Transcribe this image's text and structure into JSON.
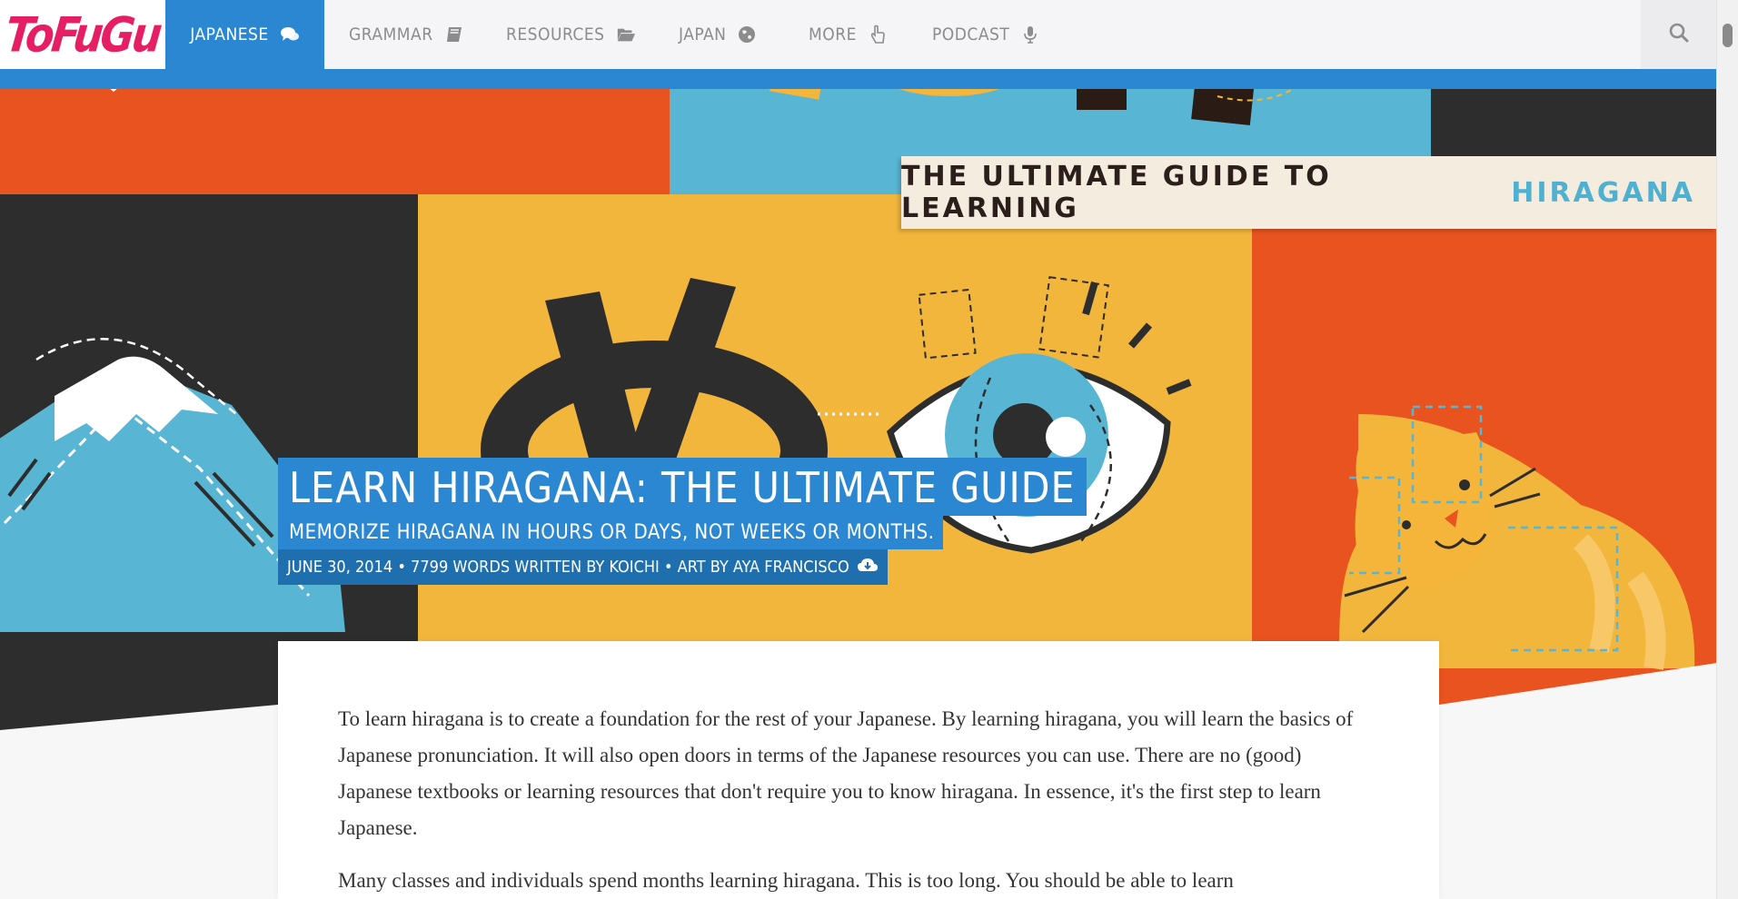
{
  "site": {
    "logo": "ToFuGu"
  },
  "nav": {
    "items": [
      {
        "label": "JAPANESE",
        "icon": "comments-icon",
        "active": true
      },
      {
        "label": "GRAMMAR",
        "icon": "book-icon"
      },
      {
        "label": "RESOURCES",
        "icon": "folder-open-icon"
      },
      {
        "label": "JAPAN",
        "icon": "globe-icon"
      },
      {
        "label": "MORE",
        "icon": "hand-pointer-icon"
      },
      {
        "label": "PODCAST",
        "icon": "microphone-icon"
      }
    ],
    "search_icon": "search-icon"
  },
  "hero": {
    "banner_prefix": "THE ULTIMATE GUIDE TO LEARNING",
    "banner_highlight": "HIRAGANA",
    "title": "LEARN HIRAGANA: THE ULTIMATE GUIDE",
    "subtitle": "MEMORIZE HIRAGANA IN HOURS OR DAYS, NOT WEEKS OR MONTHS.",
    "meta": "JUNE 30, 2014 • 7799 WORDS WRITTEN BY KOICHI • ART BY AYA FRANCISCO",
    "meta_icon": "cloud-download-icon"
  },
  "article": {
    "paragraphs": [
      "To learn hiragana is to create a foundation for the rest of your Japanese. By learning hiragana, you will learn the basics of Japanese pronunciation. It will also open doors in terms of the Japanese resources you can use. There are no (good) Japanese textbooks or learning resources that don't require you to know hiragana. In essence, it's the first step to learn Japanese.",
      "Many classes and individuals spend months learning hiragana. This is too long. You should be able to learn"
    ]
  },
  "colors": {
    "accent": "#2b87d1",
    "brand": "#e61e63",
    "hero_orange": "#e8531f",
    "hero_yellow": "#f2b63c",
    "hero_blue": "#58b6d4",
    "hero_dark": "#2d2d2d",
    "banner_highlight": "#4fb0cf"
  }
}
